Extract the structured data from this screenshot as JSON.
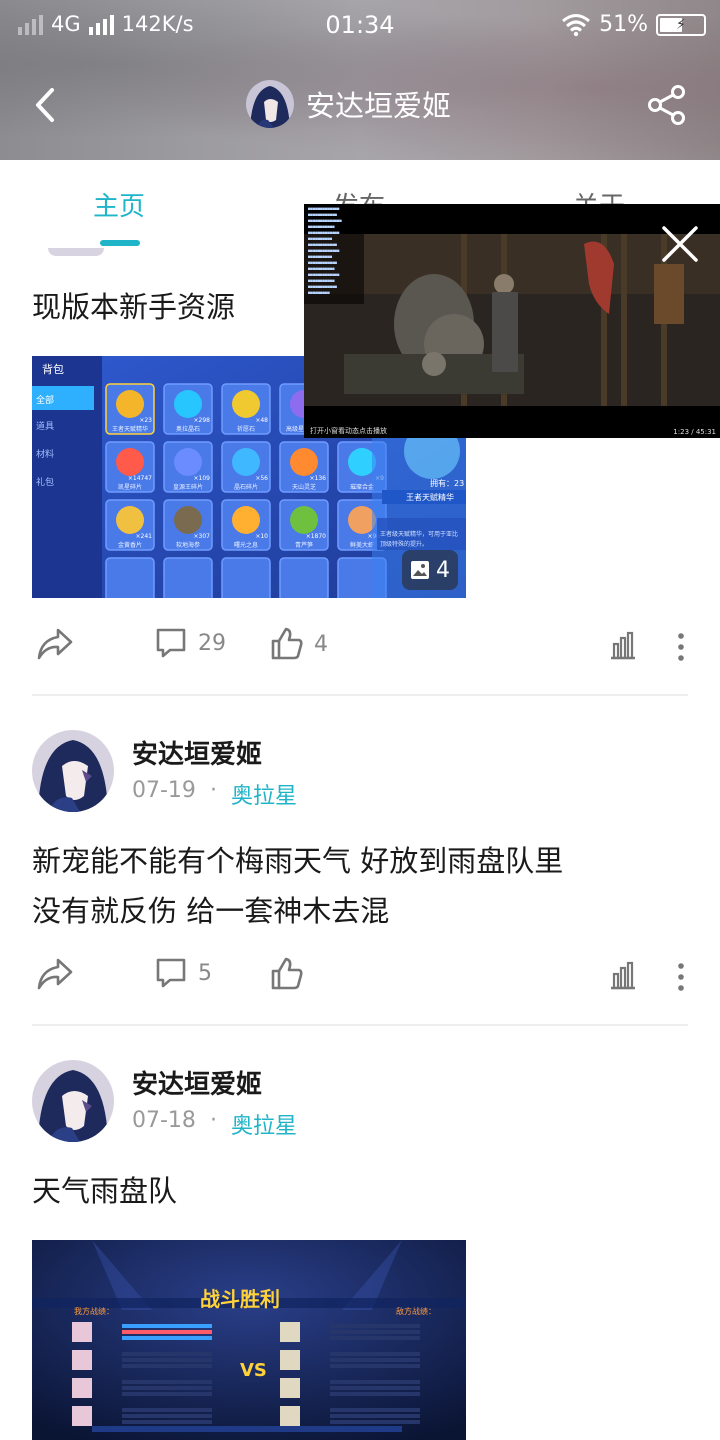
{
  "status_bar": {
    "network": "4G",
    "speed": "142K/s",
    "time": "01:34",
    "battery": "51%"
  },
  "navbar": {
    "title": "安达垣爱姬",
    "back_icon": "back-arrow-icon",
    "share_icon": "share-icon"
  },
  "tabs": [
    {
      "label": "主页",
      "active": true
    },
    {
      "label": "发布",
      "active": false
    },
    {
      "label": "关于",
      "active": false
    }
  ],
  "posts": [
    {
      "text": "现版本新手资源",
      "image_count": "4",
      "share_icon": "share-arrow-icon",
      "comments": "29",
      "likes": "4"
    },
    {
      "author": "安达垣爱姬",
      "date": "07-19",
      "separator": "·",
      "category": "奥拉星",
      "text_lines": [
        "新宠能不能有个梅雨天气 好放到雨盘队里",
        "没有就反伤 给一套神木去混"
      ],
      "comments": "5",
      "likes": ""
    },
    {
      "author": "安达垣爱姬",
      "date": "07-18",
      "separator": "·",
      "category": "奥拉星",
      "text": "天气雨盘队",
      "image_title": "战斗胜利",
      "image_left_label": "我方战绩：",
      "image_right_label": "敌方战绩："
    }
  ],
  "game_screenshot": {
    "sidebar_title": "背包",
    "sidebar_items": [
      "全部",
      "道具",
      "材料",
      "礼包"
    ],
    "items": [
      {
        "name": "王者天赋精华",
        "count": "×23"
      },
      {
        "name": "奥拉晶石",
        "count": "×298"
      },
      {
        "name": "祈愿石",
        "count": "×48"
      },
      {
        "name": "高级星语合击",
        "count": "×1"
      },
      {
        "name": "凯星碎片",
        "count": "×14747"
      },
      {
        "name": "皇源王碎片",
        "count": "×109"
      },
      {
        "name": "晶石碎片",
        "count": "×56"
      },
      {
        "name": "天山灵芝",
        "count": "×136"
      },
      {
        "name": "璀璨合金",
        "count": "×9"
      },
      {
        "name": "金黄香片",
        "count": "×241"
      },
      {
        "name": "软地海参",
        "count": "×307"
      },
      {
        "name": "曙光之息",
        "count": "×10"
      },
      {
        "name": "青芦笋",
        "count": "×1870"
      },
      {
        "name": "鲜美大虾",
        "count": "×907"
      }
    ],
    "detail_name": "王者天赋精华",
    "detail_count": "拥有：23",
    "detail_desc": "王者级天赋精华，可用于亚比顶级特殊的提升。"
  },
  "video": {
    "close_icon": "close-icon",
    "caption_left": "打开小窗看动态点击播放",
    "caption_right": "1:23 / 45:31"
  },
  "colors": {
    "accent": "#20b4c8",
    "text": "#1a1a1a",
    "muted": "#999999"
  }
}
